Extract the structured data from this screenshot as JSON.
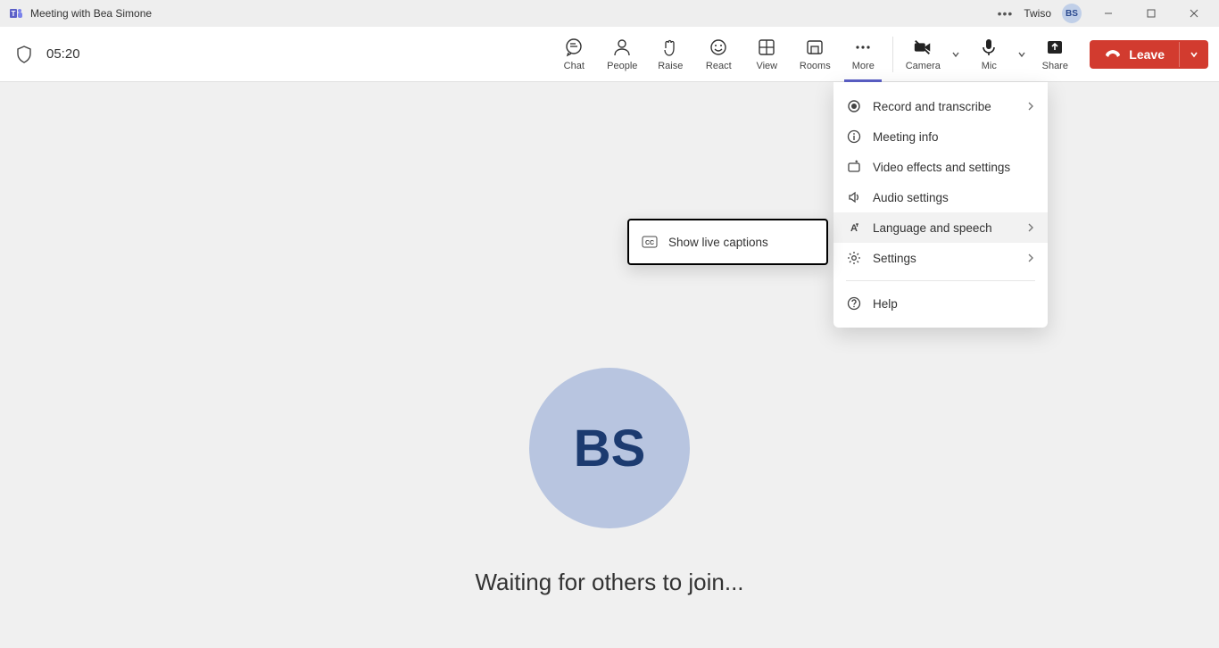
{
  "titlebar": {
    "title": "Meeting with Bea Simone",
    "account": "Twiso",
    "avatar_initials": "BS"
  },
  "toolbar": {
    "timer": "05:20",
    "buttons": {
      "chat": "Chat",
      "people": "People",
      "raise": "Raise",
      "react": "React",
      "view": "View",
      "rooms": "Rooms",
      "more": "More",
      "camera": "Camera",
      "mic": "Mic",
      "share": "Share"
    },
    "leave": "Leave"
  },
  "stage": {
    "avatar_initials": "BS",
    "waiting_text": "Waiting for others to join..."
  },
  "more_menu": {
    "record": "Record and transcribe",
    "info": "Meeting info",
    "video_effects": "Video effects and settings",
    "audio": "Audio settings",
    "language": "Language and speech",
    "settings": "Settings",
    "help": "Help"
  },
  "submenu": {
    "captions": "Show live captions"
  }
}
